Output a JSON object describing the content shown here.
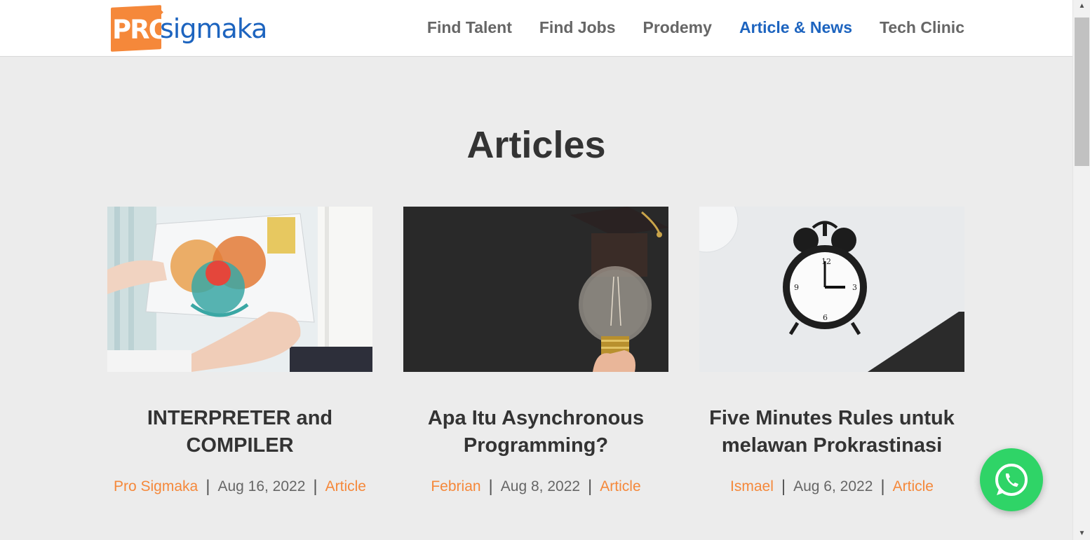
{
  "brand": {
    "logo_pro": "PRO",
    "logo_rest": "sigmaka",
    "accent": "#f5883a",
    "primary": "#1d64bf"
  },
  "nav": {
    "items": [
      {
        "label": "Find Talent",
        "active": false
      },
      {
        "label": "Find Jobs",
        "active": false
      },
      {
        "label": "Prodemy",
        "active": false
      },
      {
        "label": "Article & News",
        "active": true
      },
      {
        "label": "Tech Clinic",
        "active": false
      }
    ]
  },
  "page": {
    "title": "Articles"
  },
  "articles": [
    {
      "title": "INTERPRETER and COMPILER",
      "author": "Pro Sigmaka",
      "date": "Aug 16, 2022",
      "category": "Article",
      "image": "hands-holding-venn-diagram-paper"
    },
    {
      "title": "Apa Itu Asynchronous Programming?",
      "author": "Febrian",
      "date": "Aug 8, 2022",
      "category": "Article",
      "image": "light-bulb-with-graduation-cap"
    },
    {
      "title": "Five Minutes Rules untuk melawan Prokrastinasi",
      "author": "Ismael",
      "date": "Aug 6, 2022",
      "category": "Article",
      "image": "alarm-clock-on-white-table"
    }
  ],
  "whatsapp": {
    "icon": "whatsapp-icon",
    "color": "#2fd467"
  }
}
